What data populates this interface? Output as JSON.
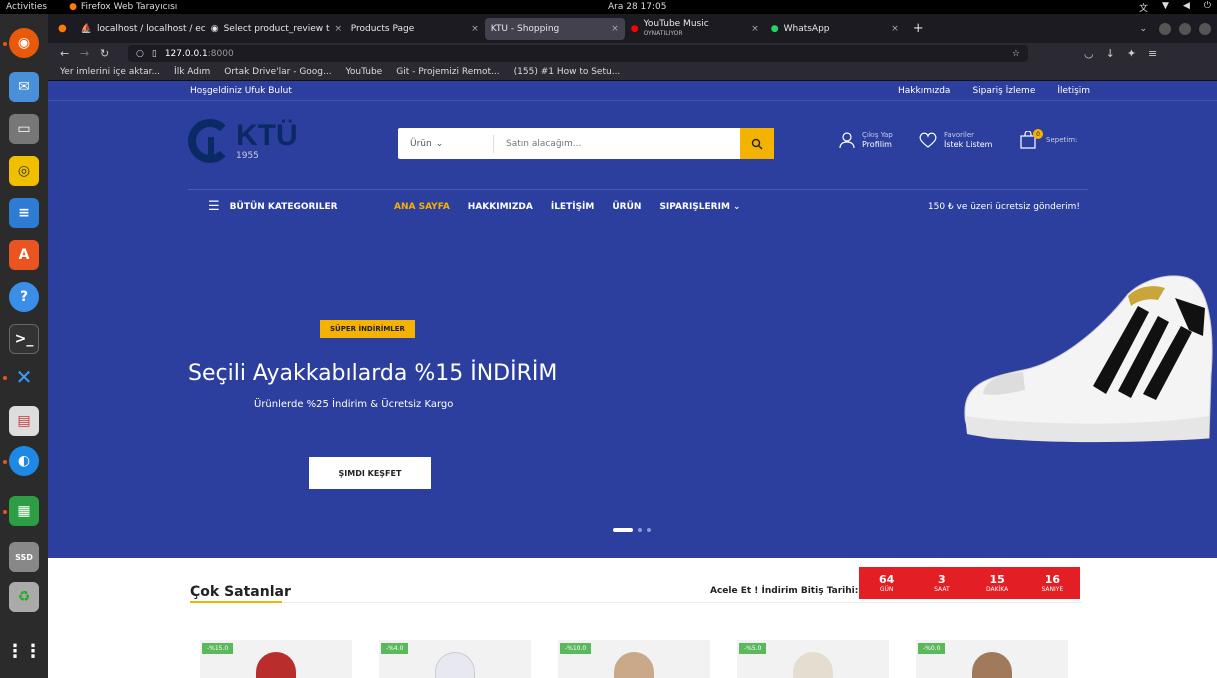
{
  "os": {
    "activities": "Activities",
    "app_name": "Firefox Web Tarayıcısı",
    "clock": "Ara 28  17:05"
  },
  "tabs": [
    {
      "label": "localhost / localhost / ec",
      "active": false
    },
    {
      "label": "Select product_review t",
      "active": false
    },
    {
      "label": "Products Page",
      "active": false
    },
    {
      "label": "KTU - Shopping",
      "active": true
    },
    {
      "label": "YouTube Music",
      "sub": "OYNATILIYOR",
      "active": false
    },
    {
      "label": "WhatsApp",
      "active": false
    }
  ],
  "url": {
    "host": "127.0.0.1",
    "port": ":8000"
  },
  "bookmarks": [
    "Yer imlerini içe aktar...",
    "İlk Adım",
    "Ortak Drive'lar - Goog...",
    "YouTube",
    "Git - Projemizi Remot...",
    "(155) #1 How to Setu..."
  ],
  "site": {
    "welcome": "Hoşgeldiniz Ufuk Bulut",
    "top_links": [
      "Hakkımızda",
      "Sipariş İzleme",
      "İletişim"
    ],
    "logo_text": "KTÜ",
    "logo_year": "1955",
    "search": {
      "category": "Ürün",
      "placeholder": "Satın alacağım..."
    },
    "account": {
      "small": "Çıkış Yap",
      "label": "Profilim"
    },
    "favorites": {
      "small": "Favoriler",
      "label": "İstek Listem"
    },
    "cart": {
      "label": "Sepetim:",
      "count": "0"
    },
    "all_categories": "BÜTÜN KATEGORILER",
    "nav": [
      "ANA SAYFA",
      "HAKKIMIZDA",
      "İLETİŞİM",
      "ÜRÜN",
      "SIPARIŞLERIM"
    ],
    "shipping": "150 ₺ ve üzeri ücretsiz gönderim!",
    "banner": {
      "tag": "SÜPER İNDİRİMLER",
      "headline": "Seçili Ayakkabılarda %15 İNDİRİM",
      "subline": "Ürünlerde %25 İndirim & Ücretsiz Kargo",
      "cta": "ŞIMDI KEŞFET"
    },
    "bestsellers_title": "Çok Satanlar",
    "hurry_text": "Acele Et ! İndirim Bitiş Tarihi:",
    "countdown": [
      {
        "value": "64",
        "label": "GÜN"
      },
      {
        "value": "3",
        "label": "SAAT"
      },
      {
        "value": "15",
        "label": "DAKİKA"
      },
      {
        "value": "16",
        "label": "SANIYE"
      }
    ],
    "products": [
      {
        "discount": "-%15.0"
      },
      {
        "discount": "-%4.0"
      },
      {
        "discount": "-%10.0"
      },
      {
        "discount": "-%5.0"
      },
      {
        "discount": "-%0.0"
      }
    ]
  },
  "colors": {
    "brand_blue": "#2c3e9e",
    "accent_yellow": "#f5b301",
    "countdown_red": "#e31e24"
  }
}
